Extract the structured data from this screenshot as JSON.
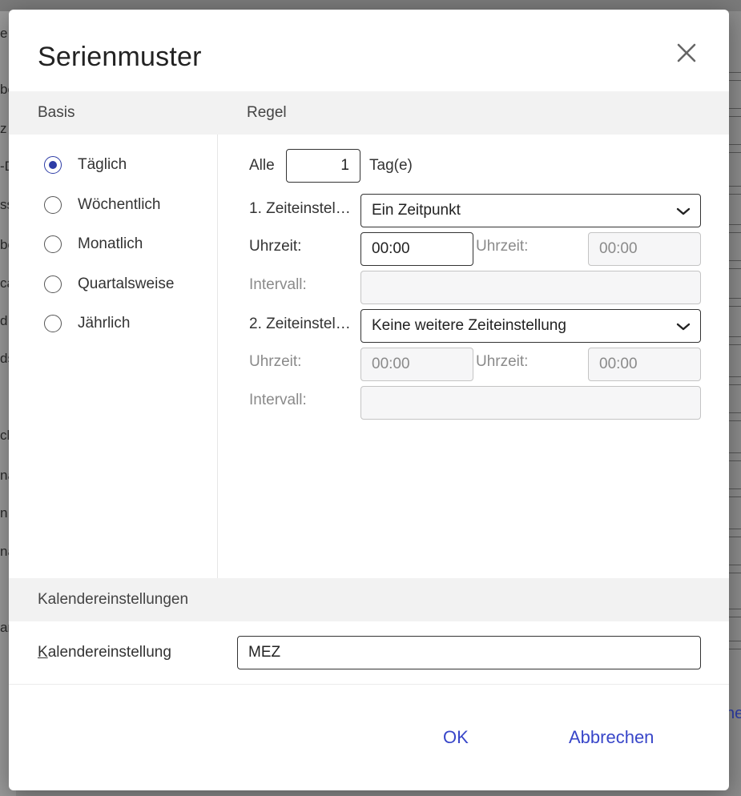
{
  "background": {
    "left_fragments": [
      "e",
      "be",
      "z",
      "-D",
      "ss",
      "be",
      "ca",
      "d",
      "ds",
      "ch",
      "na",
      "n",
      "na",
      "ar"
    ],
    "right_link_fragment": "he"
  },
  "dialog": {
    "title": "Serienmuster",
    "basis_header": "Basis",
    "regel_header": "Regel",
    "basis_options": [
      {
        "label": "Täglich",
        "checked": true
      },
      {
        "label": "Wöchentlich",
        "checked": false
      },
      {
        "label": "Monatlich",
        "checked": false
      },
      {
        "label": "Quartalsweise",
        "checked": false
      },
      {
        "label": "Jährlich",
        "checked": false
      }
    ],
    "regel": {
      "alle_label": "Alle",
      "alle_value": "1",
      "unit_label": "Tag(e)",
      "time1_label": "1. Zeiteinstel…",
      "time1_value": "Ein Zeitpunkt",
      "time1_uhrzeit_label": "Uhrzeit:",
      "time1_uhrzeit_value": "00:00",
      "time1_uhrzeit2_label": "Uhrzeit:",
      "time1_uhrzeit2_value": "00:00",
      "time1_intervall_label": "Intervall:",
      "time1_intervall_value": "",
      "time2_label": "2. Zeiteinstel…",
      "time2_value": "Keine weitere Zeiteinstellung",
      "time2_uhrzeit_label": "Uhrzeit:",
      "time2_uhrzeit_value": "00:00",
      "time2_uhrzeit2_label": "Uhrzeit:",
      "time2_uhrzeit2_value": "00:00",
      "time2_intervall_label": "Intervall:",
      "time2_intervall_value": ""
    },
    "calendar_header": "Kalendereinstellungen",
    "calendar_label_rest": "alendereinstellung",
    "calendar_label_accesskey": "K",
    "calendar_value": "MEZ",
    "ok_label": "OK",
    "cancel_label": "Abbrechen"
  },
  "colors": {
    "accent": "#2d3ca6",
    "button_text": "#3846c9",
    "section_bg": "#f2f2f2"
  }
}
